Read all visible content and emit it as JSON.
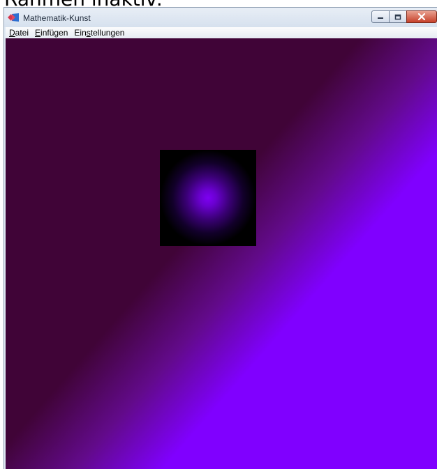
{
  "caption": "Rahmen inaktiv:",
  "window": {
    "title": "Mathematik-Kunst",
    "controls": {
      "minimize": "minimize-icon",
      "maximize": "maximize-icon",
      "close": "close-icon"
    }
  },
  "menu": {
    "items": [
      {
        "label": "Datei",
        "accesskey": "D"
      },
      {
        "label": "Einfügen",
        "accesskey": "E"
      },
      {
        "label": "Einstellungen",
        "accesskey": "s"
      }
    ]
  },
  "canvas": {
    "colors": {
      "dark_purple": "#400437",
      "bright_violet": "#8000ff",
      "square_edge": "#000000",
      "square_center": "#7d00f2"
    }
  }
}
